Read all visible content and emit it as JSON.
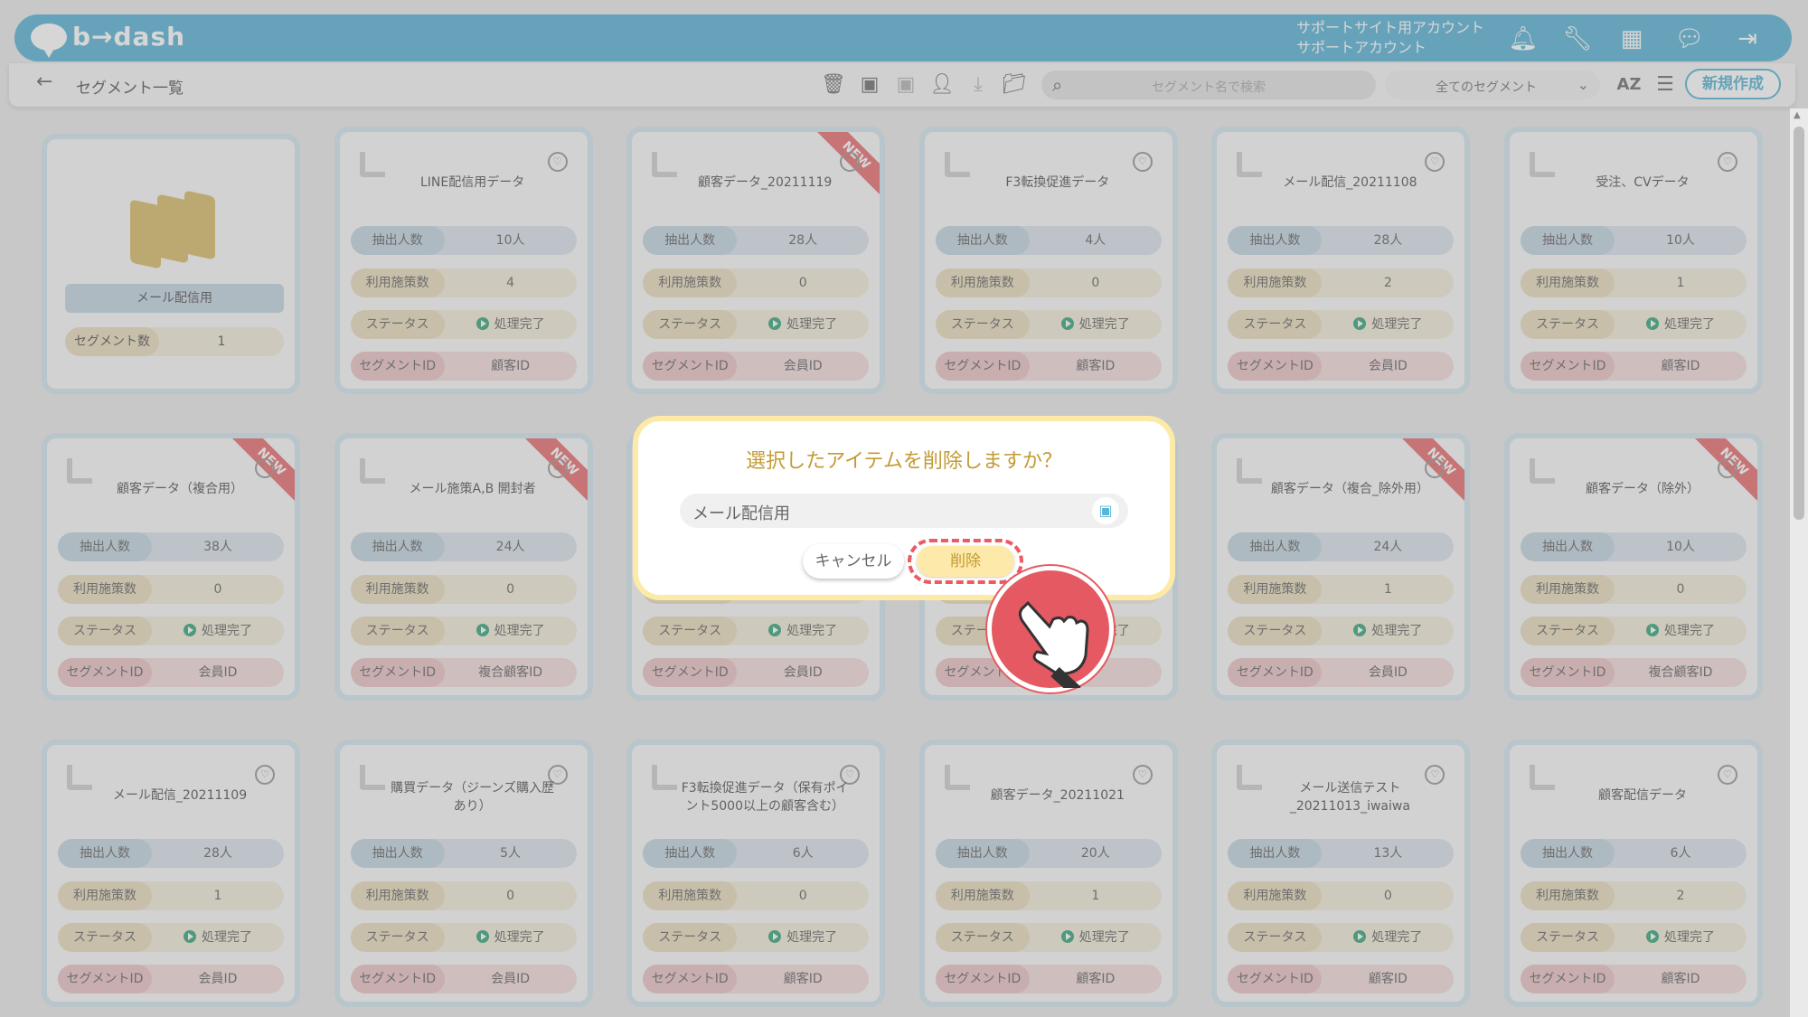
{
  "header": {
    "logo_text": "b→dash",
    "account_line1": "サポートサイト用アカウント",
    "account_line2": "サポートアカウント"
  },
  "toolbar": {
    "page_title": "セグメント一覧",
    "search_placeholder": "セグメント名で検索",
    "filter_value": "全てのセグメント",
    "sort_label": "AZ",
    "new_button": "新規作成"
  },
  "labels": {
    "extract": "抽出人数",
    "measures": "利用施策数",
    "status": "ステータス",
    "segment_id": "セグメントID",
    "segment_count": "セグメント数"
  },
  "folder": {
    "name": "メール配信用",
    "segment_count": "1"
  },
  "cards": [
    {
      "title": "LINE配信用データ",
      "count": "10人",
      "measures": "4",
      "status": "処理完了",
      "id": "顧客ID",
      "new": false,
      "badge": "♡"
    },
    {
      "title": "顧客データ_20211119",
      "count": "28人",
      "measures": "0",
      "status": "処理完了",
      "id": "会員ID",
      "new": true,
      "badge": "♡"
    },
    {
      "title": "F3転換促進データ",
      "count": "4人",
      "measures": "0",
      "status": "処理完了",
      "id": "顧客ID",
      "new": false,
      "badge": "♡"
    },
    {
      "title": "メール配信_20211108",
      "count": "28人",
      "measures": "2",
      "status": "処理完了",
      "id": "会員ID",
      "new": false,
      "badge": "♡"
    },
    {
      "title": "受注、CVデータ",
      "count": "10人",
      "measures": "1",
      "status": "処理完了",
      "id": "顧客ID",
      "new": false,
      "badge": "♡"
    },
    {
      "title": "顧客データ（複合用）",
      "count": "38人",
      "measures": "0",
      "status": "処理完了",
      "id": "会員ID",
      "new": true,
      "badge": "♡"
    },
    {
      "title": "メール施策A,B 開封者",
      "count": "24人",
      "measures": "0",
      "status": "処理完了",
      "id": "複合顧客ID",
      "new": true,
      "badge": "∞"
    },
    {
      "title": "",
      "count": "",
      "measures": "",
      "status": "処理完了",
      "id": "会員ID",
      "new": false,
      "badge": ""
    },
    {
      "title": "",
      "count": "",
      "measures": "",
      "status": "処理完了",
      "id": "",
      "new": true,
      "badge": ""
    },
    {
      "title": "顧客データ（複合_除外用）",
      "count": "24人",
      "measures": "1",
      "status": "処理完了",
      "id": "会員ID",
      "new": true,
      "badge": "♡"
    },
    {
      "title": "顧客データ（除外）",
      "count": "10人",
      "measures": "0",
      "status": "処理完了",
      "id": "複合顧客ID",
      "new": true,
      "badge": "∞"
    },
    {
      "title": "メール配信_20211109",
      "count": "28人",
      "measures": "1",
      "status": "処理完了",
      "id": "会員ID",
      "new": false,
      "badge": "♡"
    },
    {
      "title": "購買データ（ジーンズ購入歴あり）",
      "count": "5人",
      "measures": "0",
      "status": "処理完了",
      "id": "会員ID",
      "new": false,
      "badge": "♡"
    },
    {
      "title": "F3転換促進データ（保有ポイント5000以上の顧客含む）",
      "count": "6人",
      "measures": "0",
      "status": "処理完了",
      "id": "顧客ID",
      "new": false,
      "badge": "♡"
    },
    {
      "title": "顧客データ_20211021",
      "count": "20人",
      "measures": "1",
      "status": "処理完了",
      "id": "顧客ID",
      "new": false,
      "badge": "♡"
    },
    {
      "title": "メール送信テスト_20211013_iwaiwa",
      "count": "13人",
      "measures": "0",
      "status": "処理完了",
      "id": "顧客ID",
      "new": false,
      "badge": "♡"
    },
    {
      "title": "顧客配信データ",
      "count": "6人",
      "measures": "2",
      "status": "処理完了",
      "id": "顧客ID",
      "new": false,
      "badge": "♡"
    }
  ],
  "dialog": {
    "title": "選択したアイテムを削除しますか？",
    "item_name": "メール配信用",
    "cancel": "キャンセル",
    "delete": "削除"
  },
  "ribbon_text": "NEW",
  "colors": {
    "accent": "#5ab4d6",
    "danger": "#e55a62",
    "confirm": "#fde9a9"
  }
}
